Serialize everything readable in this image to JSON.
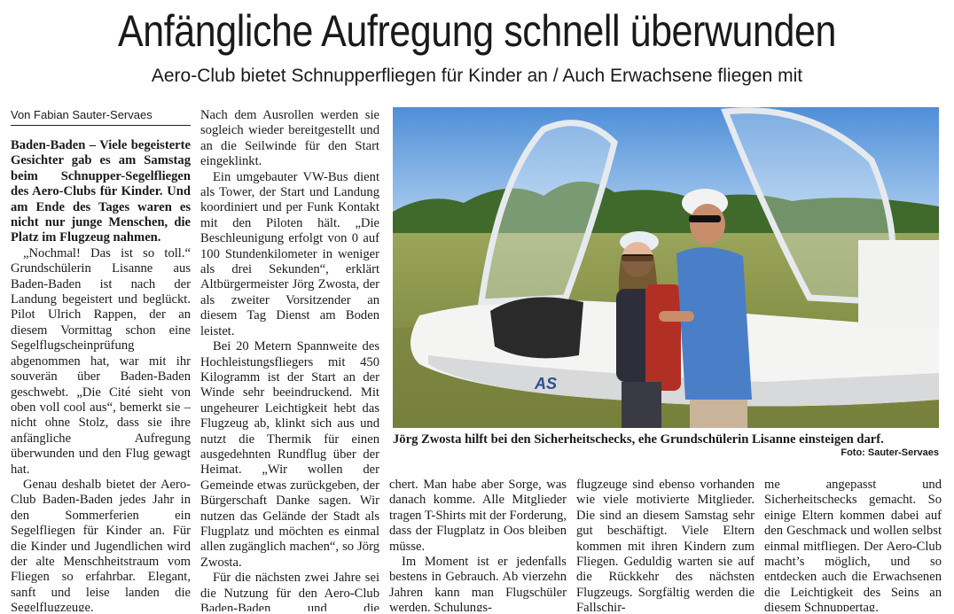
{
  "headline": "Anfängliche Aufregung schnell überwunden",
  "subheadline": "Aero-Club bietet Schnupperfliegen für Kinder an / Auch Erwachsene fliegen mit",
  "byline": "Von Fabian Sauter-Servaes",
  "lead": "Baden-Baden – Viele begeisterte Gesichter gab es am Samstag beim Schnupper-Segelfliegen des Aero-Clubs für Kinder. Und am Ende des Tages waren es nicht nur junge Menschen, die Platz im Flugzeug nahmen.",
  "col1_p1": "„Nochmal! Das ist so toll.“ Grundschülerin Lisanne aus Baden-Baden ist nach der Landung begeistert und beglückt. Pilot Ulrich Rappen, der an diesem Vormittag schon eine Segelflugscheinprüfung abgenommen hat, war mit ihr souverän über Baden-Baden geschwebt. „Die Cité sieht von oben voll cool aus“, bemerkt sie – nicht ohne Stolz, dass sie ihre anfängliche Aufregung überwunden und den Flug gewagt hat.",
  "col1_p2": "Genau deshalb bietet der Aero-Club Baden-Baden jedes Jahr in den Sommerferien ein Segelfliegen für Kinder an. Für die Kinder und Jugendlichen wird der alte Menschheitstraum vom Fliegen so erfahrbar. Elegant, sanft und leise landen die Segelflugzeuge.",
  "col2_p1": "Nach dem Ausrollen werden sie sogleich wieder bereitgestellt und an die Seilwinde für den Start eingeklinkt.",
  "col2_p2": "Ein umgebauter VW-Bus dient als Tower, der Start und Landung koordiniert und per Funk Kontakt mit den Piloten hält. „Die Beschleunigung erfolgt von 0 auf 100 Stundenkilometer in weniger als drei Sekunden“, erklärt Altbürgermeister Jörg Zwosta, der als zweiter Vorsitzender an diesem Tag Dienst am Boden leistet.",
  "col2_p3": "Bei 20 Metern Spannweite des Hochleistungsfliegers mit 450 Kilogramm ist der Start an der Winde sehr beeindruckend. Mit ungeheurer Leichtigkeit hebt das Flugzeug ab, klinkt sich aus und nutzt die Thermik für einen ausgedehnten Rundflug über der Heimat. „Wir wollen der Gemeinde etwas zurückgeben, der Bürgerschaft Danke sagen. Wir nutzen das Gelände der Stadt als Flugplatz und möchten es einmal allen zugänglich machen“, so Jörg Zwosta.",
  "col2_p4": "Für die nächsten zwei Jahre sei die Nutzung für den Aero-Club Baden-Baden und die Fliegergruppe Gaggenau gesi-",
  "col3_p1": "chert. Man habe aber Sorge, was danach komme. Alle Mitglieder tragen T-Shirts mit der Forderung, dass der Flugplatz in Oos bleiben müsse.",
  "col3_p2": "Im Moment ist er jedenfalls bestens in Gebrauch. Ab vierzehn Jahren kann man Flugschüler werden. Schulungs-",
  "col4_p1": "flugzeuge sind ebenso vorhanden wie viele motivierte Mitglieder. Die sind an diesem Samstag sehr gut beschäftigt. Viele Eltern kommen mit ihren Kindern zum Fliegen. Geduldig warten sie auf die Rückkehr des nächsten Flugzeugs. Sorgfältig werden die Fallschir-",
  "col5_p1": "me angepasst und Sicherheitschecks gemacht. So einige Eltern kommen dabei auf den Geschmack und wollen selbst einmal mitfliegen. Der Aero-Club macht’s möglich, und so entdecken auch die Erwachsenen die Leichtigkeit des Seins an diesem Schnuppertag.",
  "caption": "Jörg Zwosta hilft bei den Sicherheitschecks, ehe Grundschülerin Lisanne einsteigen darf.",
  "photo_credit": "Foto: Sauter-Servaes",
  "glider_marking": "AS"
}
